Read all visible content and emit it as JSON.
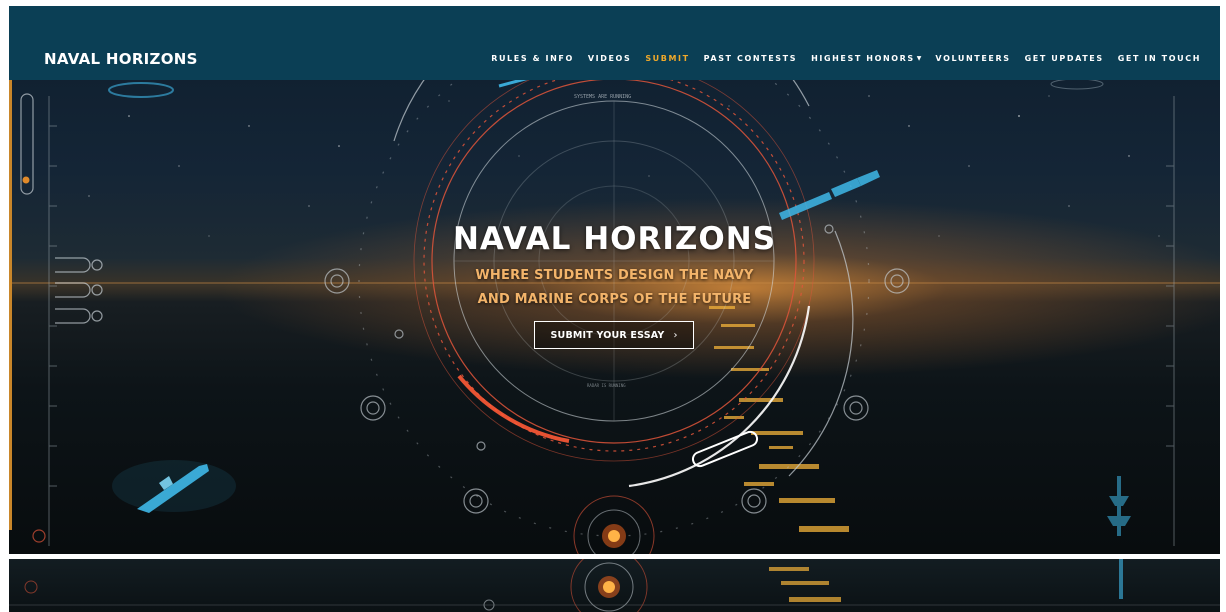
{
  "brand": {
    "logo_text": "NAVAL HORIZONS"
  },
  "nav": {
    "items": [
      {
        "label": "RULES & INFO",
        "active": false
      },
      {
        "label": "VIDEOS",
        "active": false
      },
      {
        "label": "SUBMIT",
        "active": true
      },
      {
        "label": "PAST CONTESTS",
        "active": false
      },
      {
        "label": "HIGHEST HONORS",
        "active": false,
        "has_dropdown": true
      },
      {
        "label": "VOLUNTEERS",
        "active": false
      },
      {
        "label": "GET UPDATES",
        "active": false
      },
      {
        "label": "GET IN TOUCH",
        "active": false
      }
    ],
    "dropdown_icon": "caret-down-icon"
  },
  "hero": {
    "title": "NAVAL HORIZONS",
    "subtitle_line1": "WHERE STUDENTS DESIGN THE NAVY",
    "subtitle_line2": "AND MARINE CORPS OF THE FUTURE",
    "cta_label": "SUBMIT YOUR ESSAY",
    "cta_arrow": "›",
    "hud_top_text": "SYSTEMS ARE RUNNING",
    "hud_inner_text": "RADAR IS RUNNING"
  },
  "colors": {
    "nav_bg": "#0b3f55",
    "accent": "#f0a92a",
    "subtitle": "#f3b46a",
    "hologram": "#3fb8e8",
    "hud_red": "#e0553a",
    "left_accent": "#c9862a"
  },
  "icons": {
    "cta_arrow": "chevron-right-icon",
    "satellite": "satellite-hologram-icon",
    "ship": "warship-hologram-icon",
    "core": "reactor-core-icon"
  }
}
